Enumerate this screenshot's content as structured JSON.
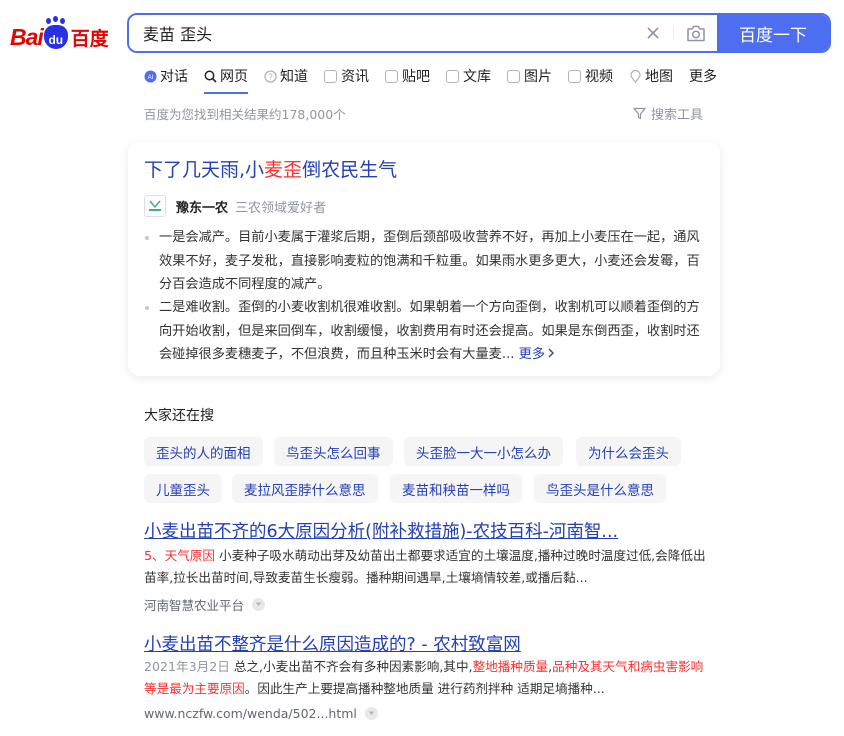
{
  "logo": {
    "bai": "Bai",
    "du_mark": "du",
    "baidu_cn": "百度"
  },
  "search": {
    "query": "麦苗 歪头",
    "button_label": "百度一下"
  },
  "tabs": [
    {
      "label": "对话",
      "icon": "ai-chat-icon"
    },
    {
      "label": "网页",
      "icon": "search-icon",
      "active": true
    },
    {
      "label": "知道",
      "icon": "question-icon"
    },
    {
      "label": "资讯",
      "icon": "news-icon"
    },
    {
      "label": "贴吧",
      "icon": "tieba-icon"
    },
    {
      "label": "文库",
      "icon": "document-icon"
    },
    {
      "label": "图片",
      "icon": "image-icon"
    },
    {
      "label": "视频",
      "icon": "video-icon"
    },
    {
      "label": "地图",
      "icon": "map-icon"
    },
    {
      "label": "更多"
    }
  ],
  "result_stats": "百度为您找到相关结果约178,000个",
  "search_tools": "搜索工具",
  "card": {
    "title_a": "下了几天雨,小",
    "title_hl": "麦歪",
    "title_b": "倒农民生气",
    "author": "豫东一农",
    "tag": "三农领域爱好者",
    "para1": "一是会减产。目前小麦属于灌浆后期，歪倒后颈部吸收营养不好，再加上小麦压在一起，通风效果不好，麦子发秕，直接影响麦粒的饱满和千粒重。如果雨水更多更大，小麦还会发霉，百分百会造成不同程度的减产。",
    "para2": "二是难收割。歪倒的小麦收割机很难收割。如果朝着一个方向歪倒，收割机可以顺着歪倒的方向开始收割，但是来回倒车，收割缓慢，收割费用有时还会提高。如果是东倒西歪，收割时还会碰掉很多麦穗麦子，不但浪费，而且种玉米时会有大量麦...",
    "more": "更多"
  },
  "related": {
    "title": "大家还在搜",
    "row1": [
      "歪头的人的面相",
      "鸟歪头怎么回事",
      "头歪脸一大一小怎么办",
      "为什么会歪头"
    ],
    "row2": [
      "儿童歪头",
      "麦拉风歪脖什么意思",
      "麦苗和秧苗一样吗",
      "鸟歪头是什么意思"
    ]
  },
  "results": [
    {
      "title": "小麦出苗不齐的6大原因分析(附补救措施)-农技百科-河南智...",
      "lead_red": "5、天气原因",
      "body": " 小麦种子吸水萌动出芽及幼苗出土都要求适宜的土壤温度,播种过晚时温度过低,会降低出苗率,拉长出苗时间,导致麦苗生长瘦弱。播种期间遇旱,土壤墒情较差,或播后黏...",
      "source": "河南智慧农业平台"
    },
    {
      "title": "小麦出苗不整齐是什么原因造成的? - 农村致富网",
      "date": "2021年3月2日",
      "body_a": " 总之,小麦出苗不齐会有多种因素影响,其中,",
      "red_a": "整地播种质量",
      "body_b": ",",
      "red_b": "品种及其天气和病虫害影响等是最为主要原因",
      "body_c": "。因此生产上要提高播种整地质量 进行药剂拌种 适期足墒播种...",
      "source": "www.nczfw.com/wenda/502...html"
    }
  ],
  "colors": {
    "brand_blue": "#4e6ef2",
    "link": "#2440b3",
    "highlight_red": "#f73131"
  }
}
